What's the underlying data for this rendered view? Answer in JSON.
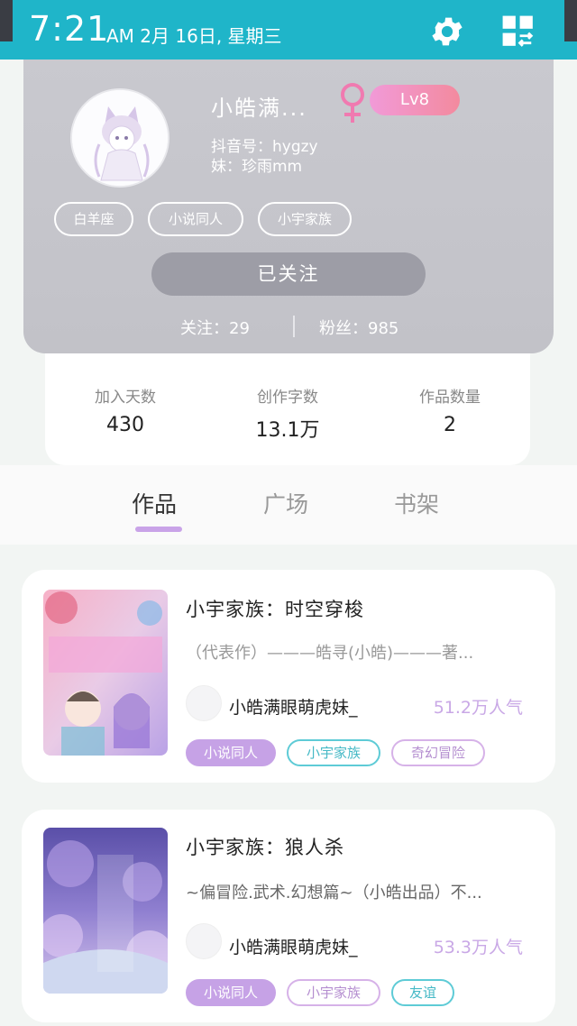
{
  "status_bar": {
    "time": "7:21",
    "date": "AM 2月 16日, 星期三",
    "icons": [
      "gear-icon",
      "apps-grid-icon"
    ]
  },
  "profile": {
    "username": "小皓满...",
    "gender_icon": "female-symbol-icon",
    "level": "Lv8",
    "douyin_id": "抖音号：hygzy",
    "sister": "妹：珍雨mm",
    "tags": [
      "白羊座",
      "小说同人",
      "小宇家族"
    ],
    "follow_button": "已关注",
    "following": "关注：29",
    "fans": "粉丝：985"
  },
  "stats": [
    {
      "label": "加入天数",
      "value": "430"
    },
    {
      "label": "创作字数",
      "value": "13.1万"
    },
    {
      "label": "作品数量",
      "value": "2"
    }
  ],
  "tabs": [
    "作品",
    "广场",
    "书架"
  ],
  "active_tab": "作品",
  "works": [
    {
      "title": "小宇家族：时空穿梭",
      "desc": "（代表作）———皓寻(小皓)———著...",
      "author": "小皓满眼萌虎妹_",
      "popularity": "51.2万人气",
      "tags": [
        {
          "label": "小说同人",
          "style": "fill"
        },
        {
          "label": "小宇家族",
          "style": "teal"
        },
        {
          "label": "奇幻冒险",
          "style": "pink"
        }
      ]
    },
    {
      "title": "小宇家族：狼人杀",
      "desc": "~偏冒险.武术.幻想篇~（小皓出品）不...",
      "author": "小皓满眼萌虎妹_",
      "popularity": "53.3万人气",
      "tags": [
        {
          "label": "小说同人",
          "style": "fill"
        },
        {
          "label": "小宇家族",
          "style": "pink"
        },
        {
          "label": "友谊",
          "style": "teal"
        }
      ]
    }
  ],
  "colors": {
    "status_bar": "#1fb5c9",
    "accent_purple": "#c6a2e6",
    "level_badge": "#f38a9e",
    "gender_symbol": "#f07ab0"
  }
}
